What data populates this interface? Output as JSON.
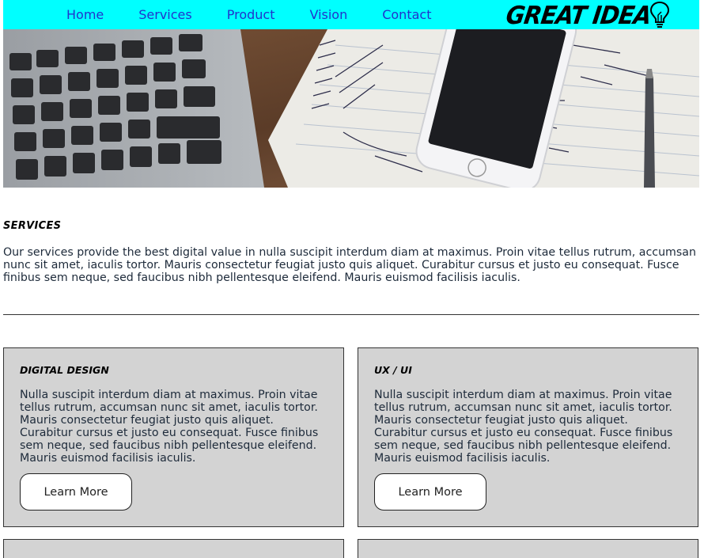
{
  "nav": {
    "items": [
      {
        "label": "Home"
      },
      {
        "label": "Services"
      },
      {
        "label": "Product"
      },
      {
        "label": "Vision"
      },
      {
        "label": "Contact"
      }
    ],
    "brand": "GREAT IDEA",
    "brand_icon": "lightbulb-icon"
  },
  "colors": {
    "nav_background": "#00ffff",
    "nav_link": "#2233cc",
    "card_background": "#d3d3d3"
  },
  "hero": {
    "image": "laptop-keyboard-phone-notebook-photo"
  },
  "services": {
    "title": "SERVICES",
    "intro": "Our services provide the best digital value in nulla suscipit interdum diam at maximus. Proin vitae tellus rutrum, accumsan nunc sit amet, iaculis tortor. Mauris consectetur feugiat justo quis aliquet. Curabitur cursus et justo eu consequat. Fusce finibus sem neque, sed faucibus nibh pellentesque eleifend. Mauris euismod facilisis iaculis."
  },
  "cards": [
    {
      "title": "DIGITAL DESIGN",
      "body": "Nulla suscipit interdum diam at maximus. Proin vitae tellus rutrum, accumsan nunc sit amet, iaculis tortor. Mauris consectetur feugiat justo quis aliquet. Curabitur cursus et justo eu consequat. Fusce finibus sem neque, sed faucibus nibh pellentesque eleifend. Mauris euismod facilisis iaculis.",
      "button": "Learn More"
    },
    {
      "title": "UX / UI",
      "body": "Nulla suscipit interdum diam at maximus. Proin vitae tellus rutrum, accumsan nunc sit amet, iaculis tortor. Mauris consectetur feugiat justo quis aliquet. Curabitur cursus et justo eu consequat. Fusce finibus sem neque, sed faucibus nibh pellentesque eleifend. Mauris euismod facilisis iaculis.",
      "button": "Learn More"
    }
  ]
}
